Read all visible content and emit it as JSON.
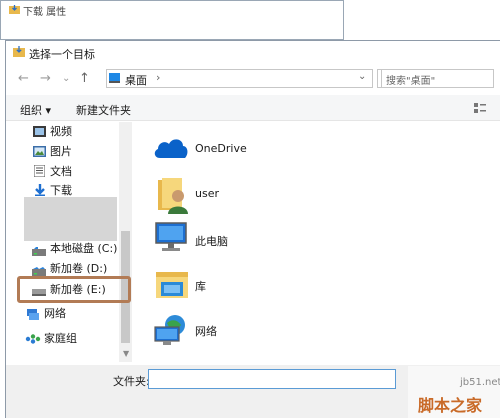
{
  "background_window": {
    "title": "下载 属性"
  },
  "dialog": {
    "title": "选择一个目标",
    "nav": {
      "back": "←",
      "forward": "→",
      "dropdown": "⌄",
      "up": "↑",
      "address": "桌面",
      "address_chevron": "›",
      "address_dropdown": "⌄",
      "refresh": "↻",
      "search_placeholder": "搜索\"桌面\""
    },
    "toolbar": {
      "organize": "组织 ▾",
      "new_folder": "新建文件夹"
    },
    "sidebar": {
      "items": [
        {
          "label": "视频",
          "icon": "video-folder-icon"
        },
        {
          "label": "图片",
          "icon": "pictures-folder-icon"
        },
        {
          "label": "文档",
          "icon": "documents-folder-icon"
        },
        {
          "label": "下载",
          "icon": "downloads-folder-icon"
        },
        {
          "label": "本地磁盘 (C:)",
          "icon": "drive-c-icon"
        },
        {
          "label": "新加卷 (D:)",
          "icon": "drive-d-icon"
        },
        {
          "label": "新加卷 (E:)",
          "icon": "drive-e-icon"
        },
        {
          "label": "网络",
          "icon": "network-icon"
        },
        {
          "label": "家庭组",
          "icon": "homegroup-icon"
        }
      ]
    },
    "content": {
      "items": [
        {
          "label": "OneDrive",
          "icon": "onedrive-icon"
        },
        {
          "label": "user",
          "icon": "user-folder-icon"
        },
        {
          "label": "此电脑",
          "icon": "this-pc-icon"
        },
        {
          "label": "库",
          "icon": "library-icon"
        },
        {
          "label": "网络",
          "icon": "network-icon"
        }
      ]
    },
    "bottom": {
      "folder_label": "文件夹:",
      "folder_value": ""
    }
  },
  "watermark": {
    "line1": "jb51.net",
    "line2": "脚本之家"
  },
  "colors": {
    "highlight": "#b27b55",
    "accent": "#0078d7"
  }
}
